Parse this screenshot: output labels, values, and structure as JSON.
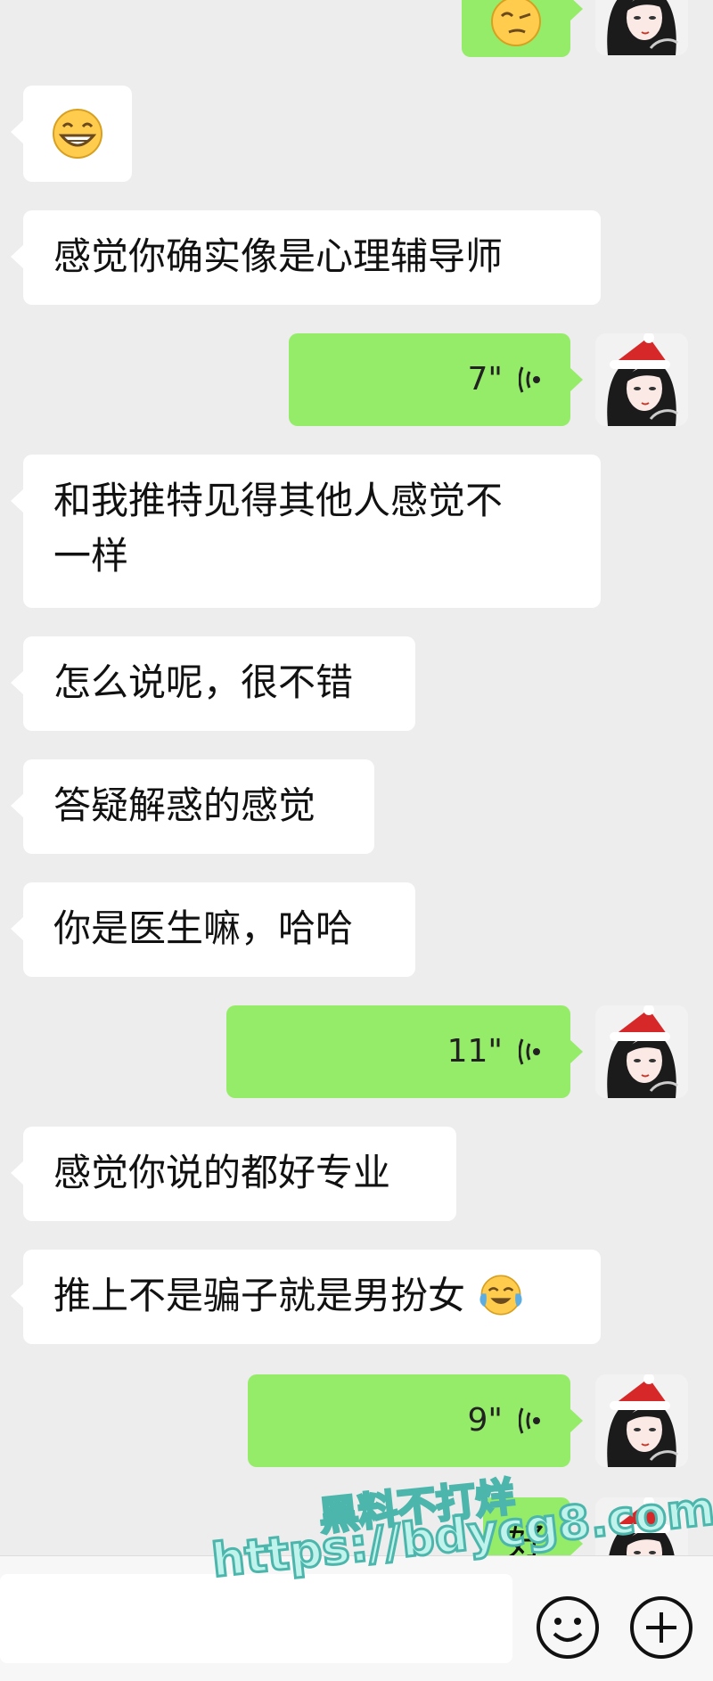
{
  "messages": [
    {
      "side": "in",
      "type": "text",
      "text": "感觉你确实像是心理辅导师"
    },
    {
      "side": "out",
      "type": "voice",
      "duration": "7\""
    },
    {
      "side": "in",
      "type": "text",
      "line1": "和我推特见得其他人感觉不",
      "line2": "一样"
    },
    {
      "side": "in",
      "type": "text",
      "text": "怎么说呢，很不错"
    },
    {
      "side": "in",
      "type": "text",
      "text": "答疑解惑的感觉"
    },
    {
      "side": "in",
      "type": "text",
      "text": "你是医生嘛，哈哈"
    },
    {
      "side": "out",
      "type": "voice",
      "duration": "11\""
    },
    {
      "side": "in",
      "type": "text",
      "text": "感觉你说的都好专业"
    },
    {
      "side": "in",
      "type": "text",
      "text": "推上不是骗子就是男扮女",
      "emoji": "laughing-crying-emoji"
    },
    {
      "side": "out",
      "type": "voice",
      "duration": "9\""
    },
    {
      "side": "out",
      "type": "text",
      "text": "好",
      "partial": true
    }
  ],
  "top_emojis": {
    "outgoing": "thinking-emoji",
    "incoming": "grinning-emoji"
  },
  "watermark": {
    "line1": "黑料不打烊",
    "line2": "https://bdycg8.com"
  },
  "input_bar": {
    "icons": [
      "emoji-icon",
      "plus-icon"
    ]
  },
  "colors": {
    "background": "#ededed",
    "incoming_bubble": "#ffffff",
    "outgoing_bubble": "#95ec69",
    "watermark_fill": "#bff3ec",
    "watermark_stroke": "#4db6ac"
  }
}
